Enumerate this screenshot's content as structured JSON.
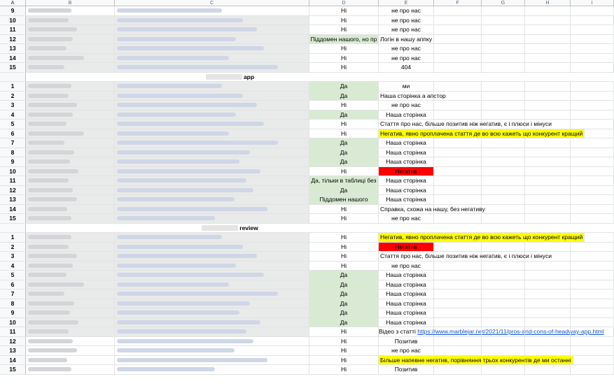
{
  "columns": [
    "A",
    "B",
    "C",
    "D",
    "E",
    "F",
    "G",
    "H",
    "I"
  ],
  "section1": {
    "rows": [
      {
        "n": "9",
        "d": "Ні",
        "e": "не про нас"
      },
      {
        "n": "10",
        "d": "Ні",
        "e": "не про нас"
      },
      {
        "n": "11",
        "d": "Ні",
        "e": "не про нас"
      },
      {
        "n": "12",
        "d": "Піддомен нашого, но пр",
        "e": "Логін в нашу аппку"
      },
      {
        "n": "13",
        "d": "Ні",
        "e": "не про нас"
      },
      {
        "n": "14",
        "d": "Ні",
        "e": "не про нас"
      },
      {
        "n": "15",
        "d": "Ні",
        "e": "404"
      }
    ]
  },
  "section2": {
    "title": "app",
    "rows": [
      {
        "n": "1",
        "d": "Да",
        "e": "ми"
      },
      {
        "n": "2",
        "d": "Да",
        "e": "Наша сторінка а апстор"
      },
      {
        "n": "3",
        "d": "Ні",
        "e": "не про нас"
      },
      {
        "n": "4",
        "d": "Да",
        "e": "Наша сторінка"
      },
      {
        "n": "5",
        "d": "Ні",
        "e": "Стаття про нас, більше позитив ніж негатив, є і плюси і мінуси"
      },
      {
        "n": "6",
        "d": "Ні",
        "e": "Негатив, явно проплачена стаття де во всю кажеть що конкурент кращий"
      },
      {
        "n": "7",
        "d": "Да",
        "e": "Наша сторінка"
      },
      {
        "n": "8",
        "d": "Да",
        "e": "Наша сторінка"
      },
      {
        "n": "9",
        "d": "Да",
        "e": "Наша сторінка"
      },
      {
        "n": "10",
        "d": "Ні",
        "e": "Негатив"
      },
      {
        "n": "11",
        "d": "Да, тільки в таблиці без",
        "e": "Наша сторінка"
      },
      {
        "n": "12",
        "d": "Да",
        "e": "Наша сторінка"
      },
      {
        "n": "13",
        "d": "Піддомен нашого",
        "e": "Наша сторінка"
      },
      {
        "n": "14",
        "d": "Ні",
        "e": "Справка, схожа на нашу, без негативу"
      },
      {
        "n": "15",
        "d": "Ні",
        "e": "не про нас"
      }
    ]
  },
  "section3": {
    "title": "review",
    "rows": [
      {
        "n": "1",
        "d": "Ні",
        "e": "Негатив, явно проплачена стаття де во всю кажеть що конкурент кращий"
      },
      {
        "n": "2",
        "d": "Ні",
        "e": "Негатив"
      },
      {
        "n": "3",
        "d": "Ні",
        "e": "Стаття про нас, більше позитив ніж негатив, є і плюси і мінуси"
      },
      {
        "n": "4",
        "d": "Ні",
        "e": "не про нас"
      },
      {
        "n": "5",
        "d": "Да",
        "e": "Наша сторінка"
      },
      {
        "n": "6",
        "d": "Да",
        "e": "Наша сторінка"
      },
      {
        "n": "7",
        "d": "Да",
        "e": "Наша сторінка"
      },
      {
        "n": "8",
        "d": "Да",
        "e": "Наша сторінка"
      },
      {
        "n": "9",
        "d": "Да",
        "e": "Наша сторінка"
      },
      {
        "n": "10",
        "d": "Да",
        "e": "Наша сторінка"
      },
      {
        "n": "11",
        "d": "Ні",
        "e": "Відео з статті ",
        "e_link": "https://www.marblejar.net/2021/11/pros-and-cons-of-headway-app.html"
      },
      {
        "n": "12",
        "d": "Ні",
        "e": "Позитив"
      },
      {
        "n": "13",
        "d": "Ні",
        "e": "не про нас"
      },
      {
        "n": "14",
        "d": "Ні",
        "e": "Більше напевне негатив, порівняння трьох конкурентів де ми останні"
      },
      {
        "n": "15",
        "d": "Ні",
        "e": "Позитив"
      }
    ]
  },
  "colors": {
    "green": "#d9ead3",
    "yellow": "#ffff00",
    "red": "#ff0000",
    "link": "#1155cc"
  }
}
